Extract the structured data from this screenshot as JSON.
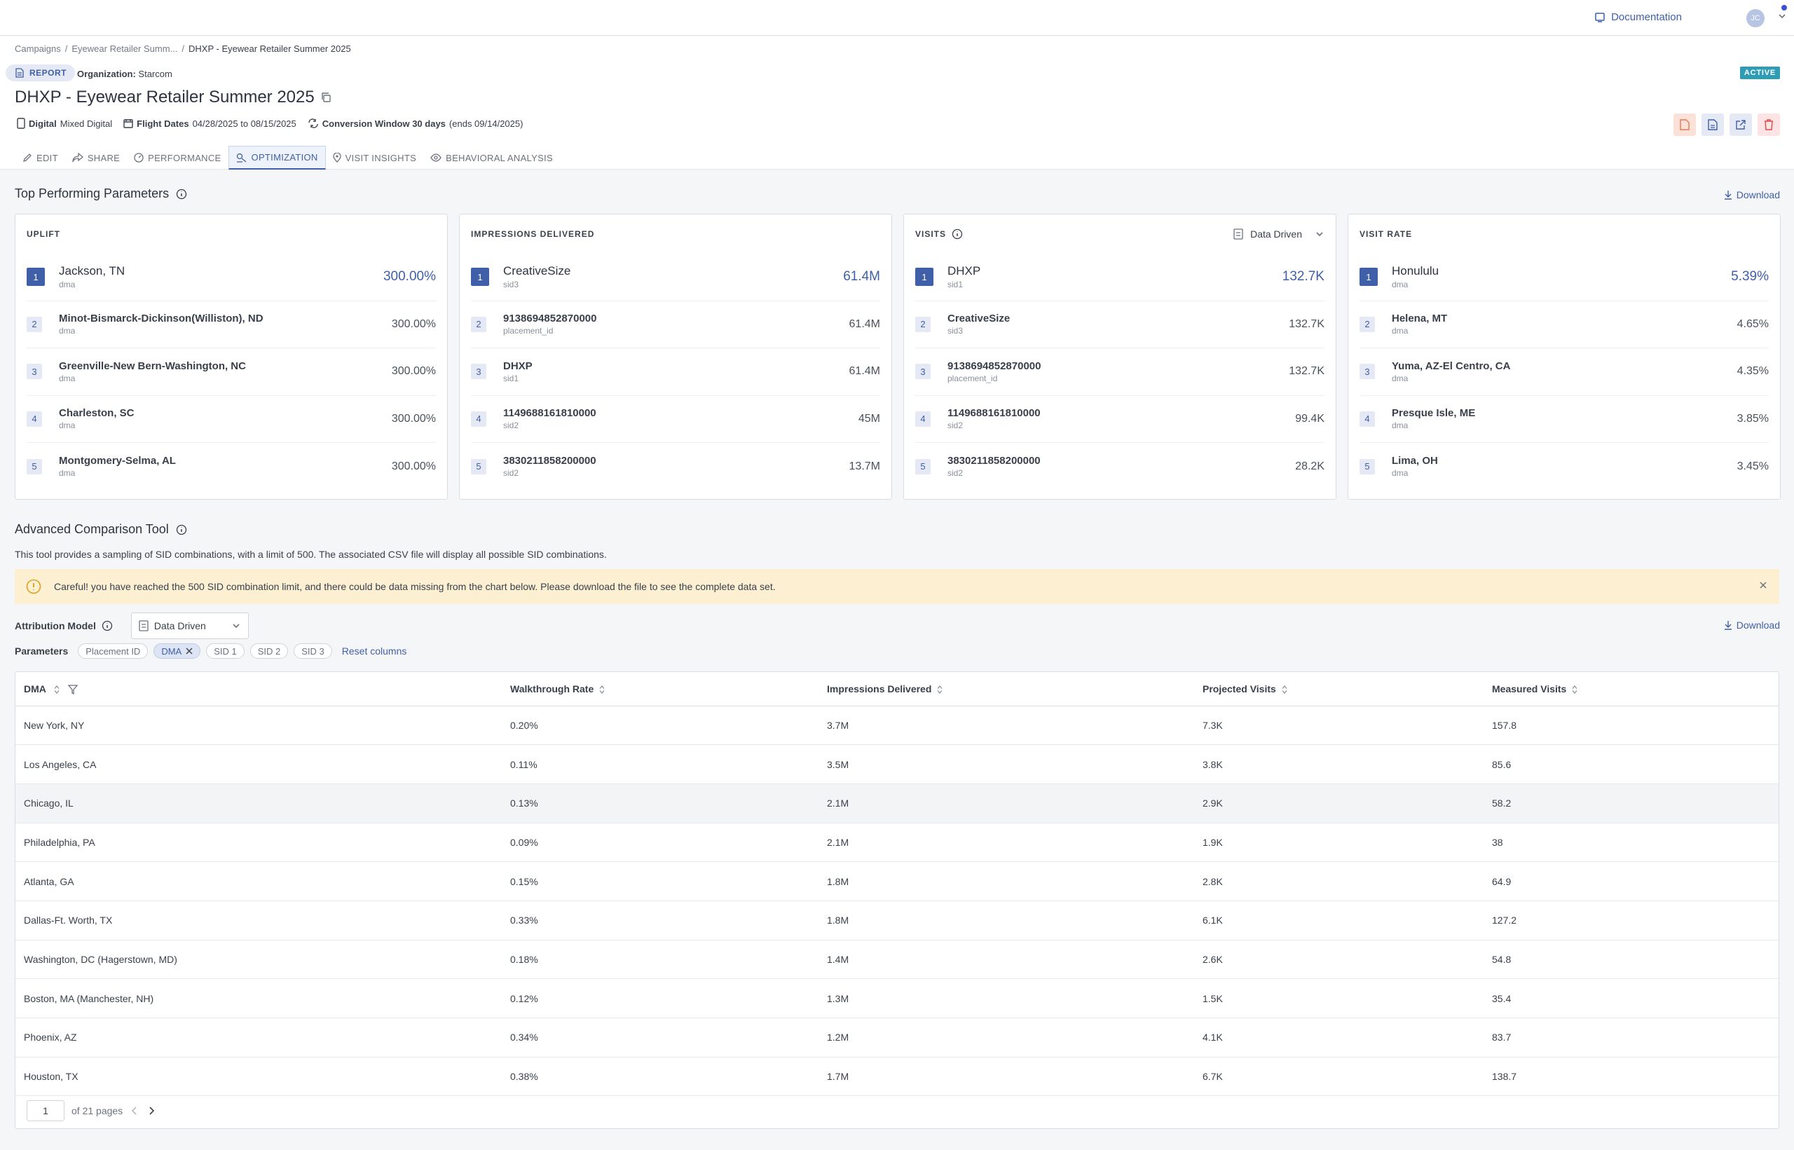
{
  "topbar": {
    "documentation": "Documentation",
    "avatar_initials": "JC"
  },
  "breadcrumb": {
    "a": "Campaigns",
    "b": "Eyewear Retailer Summ...",
    "c": "DHXP - Eyewear Retailer Summer 2025",
    "sep": "/"
  },
  "header": {
    "report_tag": "REPORT",
    "org_label": "Organization:",
    "org_value": "Starcom",
    "status": "ACTIVE",
    "title": "DHXP - Eyewear Retailer Summer 2025",
    "channel_label": "Digital",
    "channel_value": "Mixed Digital",
    "flight_label": "Flight Dates",
    "flight_value": "04/28/2025 to 08/15/2025",
    "conv_label": "Conversion Window 30 days",
    "conv_value": "(ends 09/14/2025)"
  },
  "tabs": [
    "EDIT",
    "SHARE",
    "PERFORMANCE",
    "OPTIMIZATION",
    "VISIT INSIGHTS",
    "BEHAVIORAL ANALYSIS"
  ],
  "top_params": {
    "title": "Top Performing Parameters",
    "download": "Download",
    "cards": [
      {
        "title": "UPLIFT",
        "rows": [
          {
            "rank": "1",
            "name": "Jackson, TN",
            "sub": "dma",
            "value": "300.00%"
          },
          {
            "rank": "2",
            "name": "Minot-Bismarck-Dickinson(Williston), ND",
            "sub": "dma",
            "value": "300.00%"
          },
          {
            "rank": "3",
            "name": "Greenville-New Bern-Washington, NC",
            "sub": "dma",
            "value": "300.00%"
          },
          {
            "rank": "4",
            "name": "Charleston, SC",
            "sub": "dma",
            "value": "300.00%"
          },
          {
            "rank": "5",
            "name": "Montgomery-Selma, AL",
            "sub": "dma",
            "value": "300.00%"
          }
        ]
      },
      {
        "title": "IMPRESSIONS DELIVERED",
        "rows": [
          {
            "rank": "1",
            "name": "CreativeSize",
            "sub": "sid3",
            "value": "61.4M"
          },
          {
            "rank": "2",
            "name": "9138694852870000",
            "sub": "placement_id",
            "value": "61.4M"
          },
          {
            "rank": "3",
            "name": "DHXP",
            "sub": "sid1",
            "value": "61.4M"
          },
          {
            "rank": "4",
            "name": "1149688161810000",
            "sub": "sid2",
            "value": "45M"
          },
          {
            "rank": "5",
            "name": "3830211858200000",
            "sub": "sid2",
            "value": "13.7M"
          }
        ]
      },
      {
        "title": "VISITS",
        "dropdown": "Data Driven",
        "rows": [
          {
            "rank": "1",
            "name": "DHXP",
            "sub": "sid1",
            "value": "132.7K"
          },
          {
            "rank": "2",
            "name": "CreativeSize",
            "sub": "sid3",
            "value": "132.7K"
          },
          {
            "rank": "3",
            "name": "9138694852870000",
            "sub": "placement_id",
            "value": "132.7K"
          },
          {
            "rank": "4",
            "name": "1149688161810000",
            "sub": "sid2",
            "value": "99.4K"
          },
          {
            "rank": "5",
            "name": "3830211858200000",
            "sub": "sid2",
            "value": "28.2K"
          }
        ]
      },
      {
        "title": "VISIT RATE",
        "rows": [
          {
            "rank": "1",
            "name": "Honululu",
            "sub": "dma",
            "value": "5.39%"
          },
          {
            "rank": "2",
            "name": "Helena, MT",
            "sub": "dma",
            "value": "4.65%"
          },
          {
            "rank": "3",
            "name": "Yuma, AZ-El Centro, CA",
            "sub": "dma",
            "value": "4.35%"
          },
          {
            "rank": "4",
            "name": "Presque Isle, ME",
            "sub": "dma",
            "value": "3.85%"
          },
          {
            "rank": "5",
            "name": "Lima, OH",
            "sub": "dma",
            "value": "3.45%"
          }
        ]
      }
    ]
  },
  "compare": {
    "title": "Advanced Comparison Tool",
    "description": "This tool provides a sampling of SID combinations, with a limit of 500. The associated CSV file will display all possible SID combinations.",
    "warning": "Careful! you have reached the 500 SID combination limit, and there could be data missing from the chart below. Please download the file to see the complete data set.",
    "attribution_label": "Attribution Model",
    "attribution_value": "Data Driven",
    "download": "Download",
    "params_label": "Parameters",
    "chips": [
      {
        "label": "Placement ID",
        "selected": false
      },
      {
        "label": "DMA",
        "selected": true
      },
      {
        "label": "SID 1",
        "selected": false
      },
      {
        "label": "SID 2",
        "selected": false
      },
      {
        "label": "SID 3",
        "selected": false
      }
    ],
    "reset": "Reset columns",
    "columns": [
      "DMA",
      "Walkthrough Rate",
      "Impressions Delivered",
      "Projected Visits",
      "Measured Visits"
    ],
    "rows": [
      [
        "New York, NY",
        "0.20%",
        "3.7M",
        "7.3K",
        "157.8"
      ],
      [
        "Los Angeles, CA",
        "0.11%",
        "3.5M",
        "3.8K",
        "85.6"
      ],
      [
        "Chicago, IL",
        "0.13%",
        "2.1M",
        "2.9K",
        "58.2"
      ],
      [
        "Philadelphia, PA",
        "0.09%",
        "2.1M",
        "1.9K",
        "38"
      ],
      [
        "Atlanta, GA",
        "0.15%",
        "1.8M",
        "2.8K",
        "64.9"
      ],
      [
        "Dallas-Ft. Worth, TX",
        "0.33%",
        "1.8M",
        "6.1K",
        "127.2"
      ],
      [
        "Washington, DC (Hagerstown, MD)",
        "0.18%",
        "1.4M",
        "2.6K",
        "54.8"
      ],
      [
        "Boston, MA (Manchester, NH)",
        "0.12%",
        "1.3M",
        "1.5K",
        "35.4"
      ],
      [
        "Phoenix, AZ",
        "0.34%",
        "1.2M",
        "4.1K",
        "83.7"
      ],
      [
        "Houston, TX",
        "0.38%",
        "1.7M",
        "6.7K",
        "138.7"
      ]
    ],
    "page_value": "1",
    "page_total": "of 21 pages"
  }
}
